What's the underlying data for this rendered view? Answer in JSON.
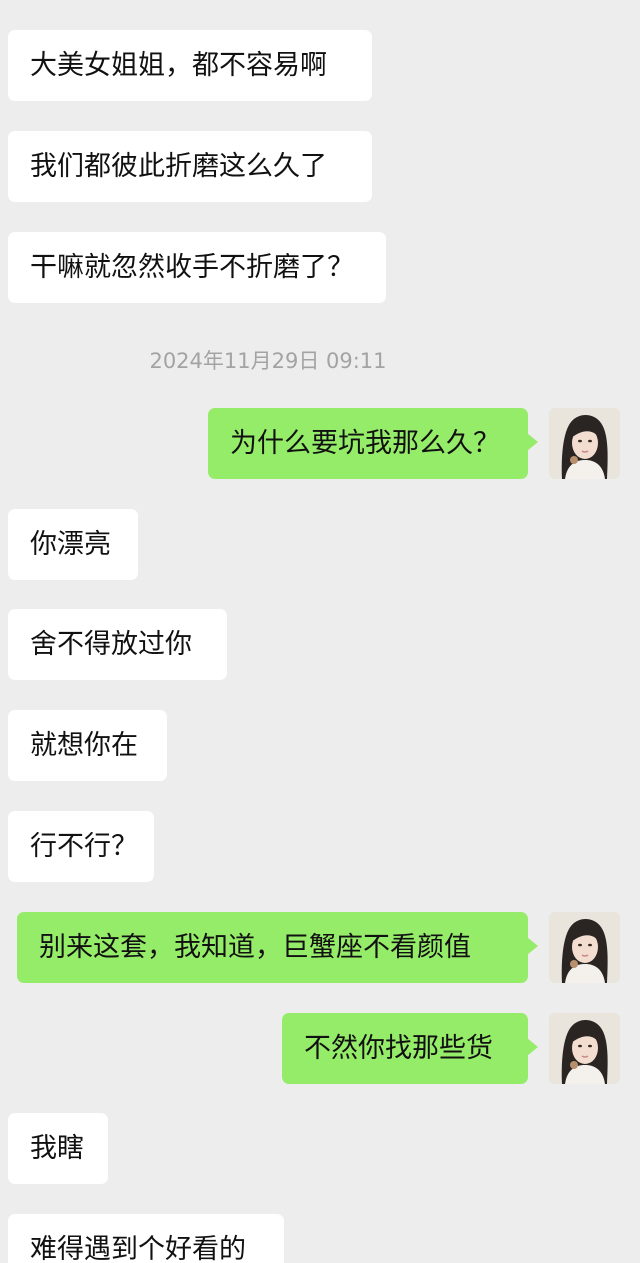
{
  "conversation": {
    "timestamp": "2024年11月29日 09:11",
    "messages": [
      {
        "side": "left",
        "text": "大美女姐姐，都不容易啊"
      },
      {
        "side": "left",
        "text": "我们都彼此折磨这么久了"
      },
      {
        "side": "left",
        "text": "干嘛就忽然收手不折磨了？"
      },
      {
        "side": "right",
        "text": "为什么要坑我那么久？"
      },
      {
        "side": "left",
        "text": "你漂亮"
      },
      {
        "side": "left",
        "text": "舍不得放过你"
      },
      {
        "side": "left",
        "text": "就想你在"
      },
      {
        "side": "left",
        "text": "行不行？"
      },
      {
        "side": "right",
        "text": "别来这套，我知道，巨蟹座不看颜值"
      },
      {
        "side": "right",
        "text": "不然你找那些货"
      },
      {
        "side": "left",
        "text": "我瞎"
      },
      {
        "side": "left",
        "text": "难得遇到个好看的"
      }
    ]
  },
  "colors": {
    "background": "#ededed",
    "incoming_bubble": "#ffffff",
    "outgoing_bubble": "#95ec69",
    "timestamp_text": "#a3a3a3"
  },
  "icons": {
    "avatar": "user-avatar-photo"
  }
}
